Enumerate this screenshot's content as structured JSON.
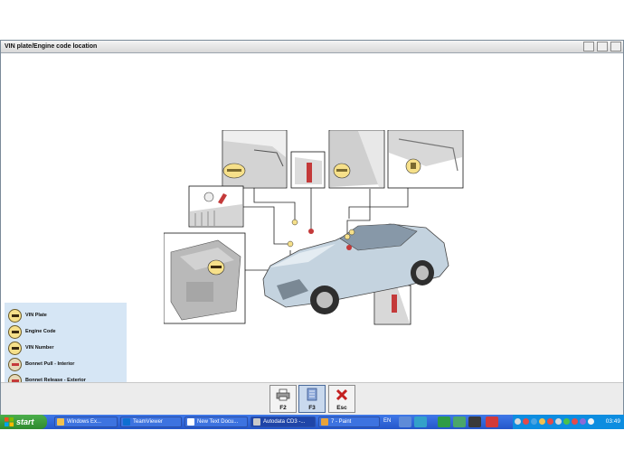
{
  "window": {
    "title": "VIN plate/Engine code location"
  },
  "legend": {
    "items": [
      {
        "label": "VIN Plate"
      },
      {
        "label": "Engine Code"
      },
      {
        "label": "VIN Number"
      },
      {
        "label": "Bonnet Pull - Interior"
      },
      {
        "label": "Bonnet Release - Exterior"
      }
    ]
  },
  "buttons": {
    "f2": "F2",
    "f3": "F3",
    "esc": "Esc"
  },
  "taskbar": {
    "start": "start",
    "items": [
      {
        "label": "Windows Ex..."
      },
      {
        "label": "TeamViewer"
      },
      {
        "label": "New Text Docu..."
      },
      {
        "label": "Autodata CD3 -..."
      },
      {
        "label": "7 - Paint"
      }
    ],
    "language": "EN",
    "clock": "03:49"
  },
  "colors": {
    "accent": "#2456c9",
    "legend_bg": "#d6e6f5",
    "marker_yellow": "#f6e08a",
    "marker_red": "#c43a3a",
    "esc_red": "#c42020"
  }
}
